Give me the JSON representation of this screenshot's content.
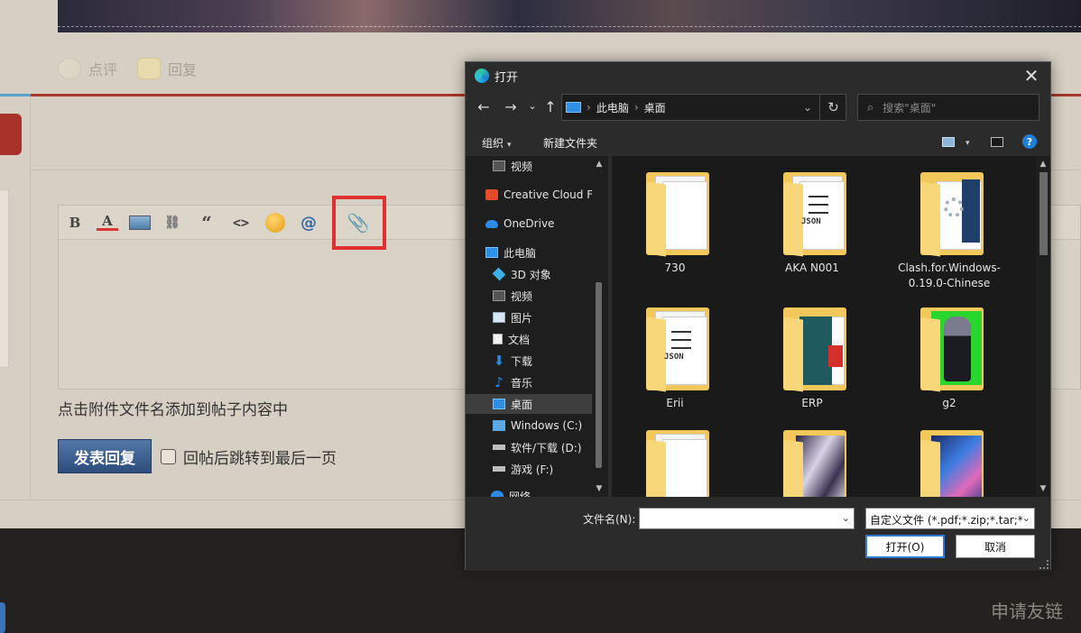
{
  "forum": {
    "actions": [
      {
        "label": "点评",
        "icon": "comment-icon"
      },
      {
        "label": "回复",
        "icon": "reply-icon"
      }
    ],
    "editor": {
      "toolbar": [
        "B",
        "A",
        "image",
        "link",
        "“",
        "<>",
        "emoji",
        "@",
        "attachment"
      ],
      "bold": "B",
      "color": "A",
      "quote": "“",
      "code": "<>",
      "at": "@",
      "attach_glyph": "📎"
    },
    "hint": "点击附件文件名添加到帖子内容中",
    "submit_label": "发表回复",
    "checkbox_label": "回帖后跳转到最后一页",
    "checkbox_checked": false,
    "footer_link": "申请友链",
    "highlight_color": "#e03030"
  },
  "dialog": {
    "title": "打开",
    "close_glyph": "✕",
    "nav": {
      "back": "←",
      "forward": "→",
      "recent": "⌄",
      "up": "↑"
    },
    "breadcrumb": [
      "此电脑",
      "桌面"
    ],
    "breadcrumb_sep": "›",
    "address_dropdown": "⌄",
    "refresh_glyph": "↻",
    "search_placeholder": "搜索\"桌面\"",
    "search_glyph": "⌕",
    "commands": {
      "organize": "组织",
      "new_folder": "新建文件夹",
      "dropdown": "▾",
      "help": "?"
    },
    "nav_pane": [
      {
        "label": "视频",
        "icon": "video-icon"
      },
      {
        "label": "Creative Cloud F",
        "icon": "creative-cloud-icon"
      },
      {
        "label": "OneDrive",
        "icon": "onedrive-icon"
      },
      {
        "label": "此电脑",
        "icon": "this-pc-icon"
      },
      {
        "label": "3D 对象",
        "icon": "3d-objects-icon"
      },
      {
        "label": "视频",
        "icon": "video-icon"
      },
      {
        "label": "图片",
        "icon": "pictures-icon"
      },
      {
        "label": "文档",
        "icon": "documents-icon"
      },
      {
        "label": "下载",
        "icon": "downloads-icon"
      },
      {
        "label": "音乐",
        "icon": "music-icon"
      },
      {
        "label": "桌面",
        "icon": "desktop-icon",
        "selected": true
      },
      {
        "label": "Windows (C:)",
        "icon": "windows-drive-icon"
      },
      {
        "label": "软件/下载 (D:)",
        "icon": "drive-icon"
      },
      {
        "label": "游戏 (F:)",
        "icon": "drive-icon"
      },
      {
        "label": "网络",
        "icon": "network-icon"
      }
    ],
    "files": [
      {
        "name": "730",
        "kind": "doc-folder"
      },
      {
        "name": "AKA N001",
        "kind": "json-folder"
      },
      {
        "name": "Clash.for.Windows-0.19.0-Chinese",
        "kind": "app-folder"
      },
      {
        "name": "Erii",
        "kind": "json-folder"
      },
      {
        "name": "ERP",
        "kind": "teal-folder"
      },
      {
        "name": "g2",
        "kind": "green-art-folder"
      },
      {
        "name": "",
        "kind": "doc-folder"
      },
      {
        "name": "",
        "kind": "anime-folder"
      },
      {
        "name": "",
        "kind": "blue-art-folder"
      }
    ],
    "json_label": "JSON",
    "filename_label": "文件名(N):",
    "filename_value": "",
    "filetype": "自定义文件 (*.pdf;*.zip;*.tar;*.t",
    "field_dropdown": "⌄",
    "open_label": "打开(O)",
    "cancel_label": "取消",
    "scroll_up": "▲",
    "scroll_down": "▼"
  }
}
